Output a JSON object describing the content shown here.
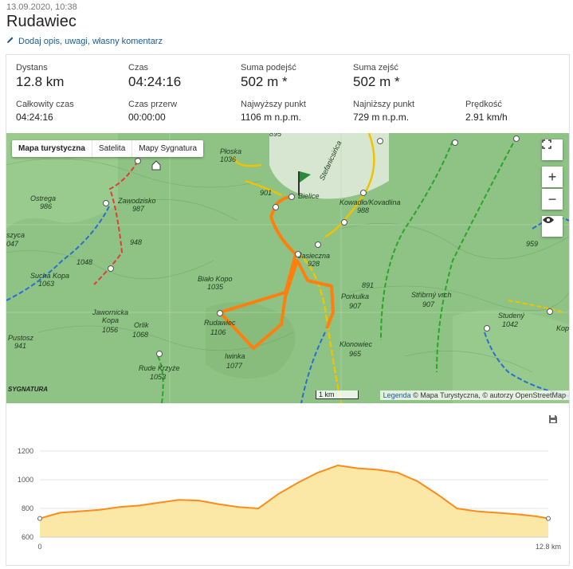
{
  "header": {
    "date": "13.09.2020, 10:38",
    "title": "Rudawiec",
    "edit_link": "Dodaj opis, uwagi, własny komentarz"
  },
  "stats": [
    {
      "label": "Dystans",
      "value": "12.8 km",
      "size": "big"
    },
    {
      "label": "Czas",
      "value": "04:24:16",
      "size": "big"
    },
    {
      "label": "Suma podejść",
      "value": "502 m *",
      "size": "big"
    },
    {
      "label": "Suma zejść",
      "value": "502 m *",
      "size": "big"
    },
    {
      "label": "Całkowity czas",
      "value": "04:24:16",
      "size": "small"
    },
    {
      "label": "Czas przerw",
      "value": "00:00:00",
      "size": "small"
    },
    {
      "label": "Najwyższy punkt",
      "value": "1106 m n.p.m.",
      "size": "small"
    },
    {
      "label": "Najniższy punkt",
      "value": "729 m n.p.m.",
      "size": "small"
    },
    {
      "label": "Prędkość",
      "value": "2.91 km/h",
      "size": "small"
    }
  ],
  "map": {
    "types": [
      "Mapa turystyczna",
      "Satelita",
      "Mapy Sygnatura"
    ],
    "zoom_in": "+",
    "zoom_out": "−",
    "scale": "1 km",
    "attribution_link": "Legenda",
    "attribution_text": "© Mapa Turystyczna, © autorzy OpenStreetMap",
    "logo": "SYGNATURA",
    "route_color": "#ff7f0e",
    "labels": [
      {
        "text": "Płoska",
        "sub": "1036"
      },
      {
        "text": "Ostrega",
        "sub": "986"
      },
      {
        "text": "Zawodzisko",
        "sub": "987"
      },
      {
        "text": "948",
        "sub": ""
      },
      {
        "text": "1048",
        "sub": ""
      },
      {
        "text": "Sucha Kopa",
        "sub": "1063"
      },
      {
        "text": "Biało Kopo",
        "sub": "1035"
      },
      {
        "text": "Jawornicka",
        "sub": "Kopa"
      },
      {
        "text": "1056",
        "sub": ""
      },
      {
        "text": "Orlik",
        "sub": "1068"
      },
      {
        "text": "Pustosz",
        "sub": "941"
      },
      {
        "text": "Rudawiec",
        "sub": "1106"
      },
      {
        "text": "Iwinka",
        "sub": "1077"
      },
      {
        "text": "Rude Krzyże",
        "sub": "1053"
      },
      {
        "text": "Kowadło/Kovadlina",
        "sub": "988"
      },
      {
        "text": "Stefanicsińca",
        "sub": ""
      },
      {
        "text": "Jasieczna",
        "sub": "928"
      },
      {
        "text": "891",
        "sub": ""
      },
      {
        "text": "Porkulka",
        "sub": "907"
      },
      {
        "text": "Střibrný vrch",
        "sub": "907"
      },
      {
        "text": "Klonowiec",
        "sub": "965"
      },
      {
        "text": "Studený",
        "sub": "1042"
      },
      {
        "text": "959",
        "sub": ""
      },
      {
        "text": "Bielice",
        "sub": ""
      },
      {
        "text": "901",
        "sub": ""
      },
      {
        "text": "895",
        "sub": ""
      },
      {
        "text": "szyca",
        "sub": "047"
      },
      {
        "text": "Kop",
        "sub": ""
      }
    ]
  },
  "chart_data": {
    "type": "area",
    "x": [
      0,
      0.5,
      1,
      1.5,
      2,
      2.5,
      3,
      3.5,
      4,
      4.5,
      5,
      5.5,
      6,
      6.5,
      7,
      7.5,
      8,
      8.5,
      9,
      9.5,
      10,
      10.5,
      11,
      11.5,
      12,
      12.5,
      12.8
    ],
    "values": [
      730,
      770,
      780,
      790,
      810,
      820,
      840,
      860,
      855,
      830,
      810,
      800,
      900,
      980,
      1050,
      1100,
      1080,
      1070,
      1050,
      990,
      900,
      800,
      780,
      770,
      760,
      745,
      730
    ],
    "ylim": [
      600,
      1250
    ],
    "yticks": [
      600,
      800,
      1000,
      1200
    ],
    "xtick_labels": [
      "0",
      "12.8 km"
    ],
    "line_color": "#ff8c1a",
    "fill_color": "#fbe8a6"
  }
}
